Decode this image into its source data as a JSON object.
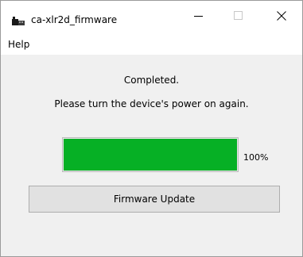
{
  "window": {
    "title": "ca-xlr2d_firmware",
    "controls": {
      "minimize_icon": "minimize-icon",
      "maximize_icon": "maximize-icon",
      "close_icon": "close-icon"
    }
  },
  "menu": {
    "items": [
      {
        "label": "Help"
      }
    ]
  },
  "status": {
    "line1": "Completed.",
    "line2": "Please turn the device's power on again."
  },
  "progress": {
    "value": 100,
    "label": "100%",
    "fill_color": "#06b025"
  },
  "actions": {
    "firmware_update_label": "Firmware Update"
  }
}
